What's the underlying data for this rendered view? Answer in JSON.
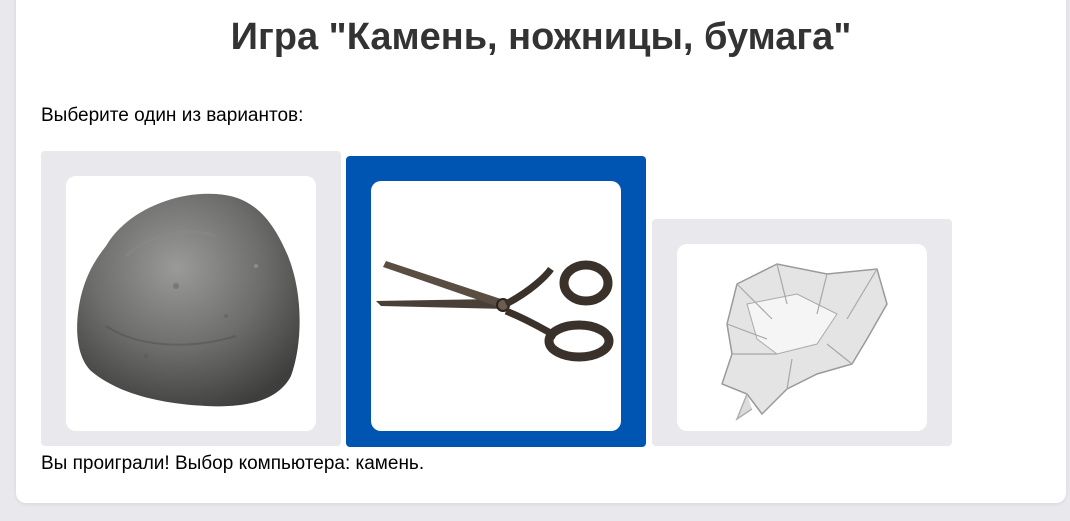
{
  "game": {
    "title": "Игра \"Камень, ножницы, бумага\"",
    "prompt": "Выберите один из вариантов:",
    "result": "Вы проиграли! Выбор компьютера: камень."
  },
  "options": [
    {
      "id": "rock",
      "icon": "rock-icon",
      "selected": false
    },
    {
      "id": "scissors",
      "icon": "scissors-icon",
      "selected": true
    },
    {
      "id": "paper",
      "icon": "paper-icon",
      "selected": false
    }
  ],
  "colors": {
    "selected_bg": "#0055b3",
    "option_bg": "#e8e8ed",
    "title": "#333333"
  }
}
